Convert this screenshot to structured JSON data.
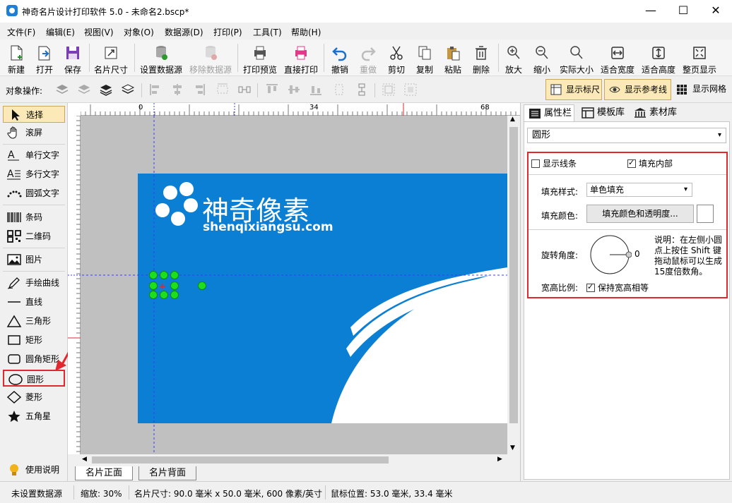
{
  "window": {
    "title": "神奇名片设计打印软件 5.0 - 未命名2.bscp*",
    "minimize": "—",
    "maximize": "☐",
    "close": "✕"
  },
  "menu": [
    "文件(F)",
    "编辑(E)",
    "视图(V)",
    "对象(O)",
    "数据源(D)",
    "打印(P)",
    "工具(T)",
    "帮助(H)"
  ],
  "toolbar": {
    "new": "新建",
    "open": "打开",
    "save": "保存",
    "card_size": "名片尺寸",
    "set_datasource": "设置数据源",
    "remove_datasource": "移除数据源",
    "print_preview": "打印预览",
    "direct_print": "直接打印",
    "undo": "撤销",
    "redo": "重做",
    "cut": "剪切",
    "copy": "复制",
    "paste": "粘贴",
    "delete": "删除",
    "zoom_in": "放大",
    "zoom_out": "缩小",
    "actual_size": "实际大小",
    "fit_width": "适合宽度",
    "fit_height": "适合高度",
    "fit_page": "整页显示"
  },
  "objbar": {
    "label": "对象操作:",
    "show_ruler": "显示标尺",
    "show_guides": "显示参考线",
    "show_grid": "显示网格"
  },
  "tools": {
    "select": "选择",
    "scroll": "滚屏",
    "single_text": "单行文字",
    "multi_text": "多行文字",
    "arc_text": "圆弧文字",
    "barcode": "条码",
    "qrcode": "二维码",
    "image": "图片",
    "freehand": "手绘曲线",
    "line": "直线",
    "triangle": "三角形",
    "rect": "矩形",
    "round_rect": "圆角矩形",
    "circle": "圆形",
    "diamond": "菱形",
    "star": "五角星",
    "help": "使用说明"
  },
  "ruler": {
    "t0": "0",
    "t34": "34",
    "t68": "68"
  },
  "card": {
    "brand_cn": "神奇像素",
    "brand_en": "shenqixiangsu.com"
  },
  "page_tabs": {
    "front": "名片正面",
    "back": "名片背面"
  },
  "panel": {
    "tab_props": "属性栏",
    "tab_templates": "模板库",
    "tab_assets": "素材库",
    "object_type": "圆形",
    "show_line": "显示线条",
    "show_line_checked": false,
    "fill_inside": "填充内部",
    "fill_inside_checked": true,
    "fill_style_label": "填充样式:",
    "fill_style_value": "单色填充",
    "fill_color_label": "填充颜色:",
    "fill_color_button": "填充颜色和透明度...",
    "rotation_label": "旋转角度:",
    "rotation_value": "0",
    "rotation_desc": "说明：在左侧小圆点上按住 Shift 键拖动鼠标可以生成15度倍数角。",
    "aspect_label": "宽高比例:",
    "aspect_keep": "保持宽高相等",
    "aspect_checked": true
  },
  "status": {
    "datasource": "未设置数据源",
    "zoom": "缩放: 30%",
    "card_size": "名片尺寸: 90.0 毫米 x 50.0 毫米, 600 像素/英寸",
    "mouse_pos": "鼠标位置: 53.0 毫米, 33.4 毫米"
  },
  "colors": {
    "card_blue": "#0a7fd3",
    "highlight_red": "#e0282e",
    "handle_green": "#1ddf1d"
  }
}
